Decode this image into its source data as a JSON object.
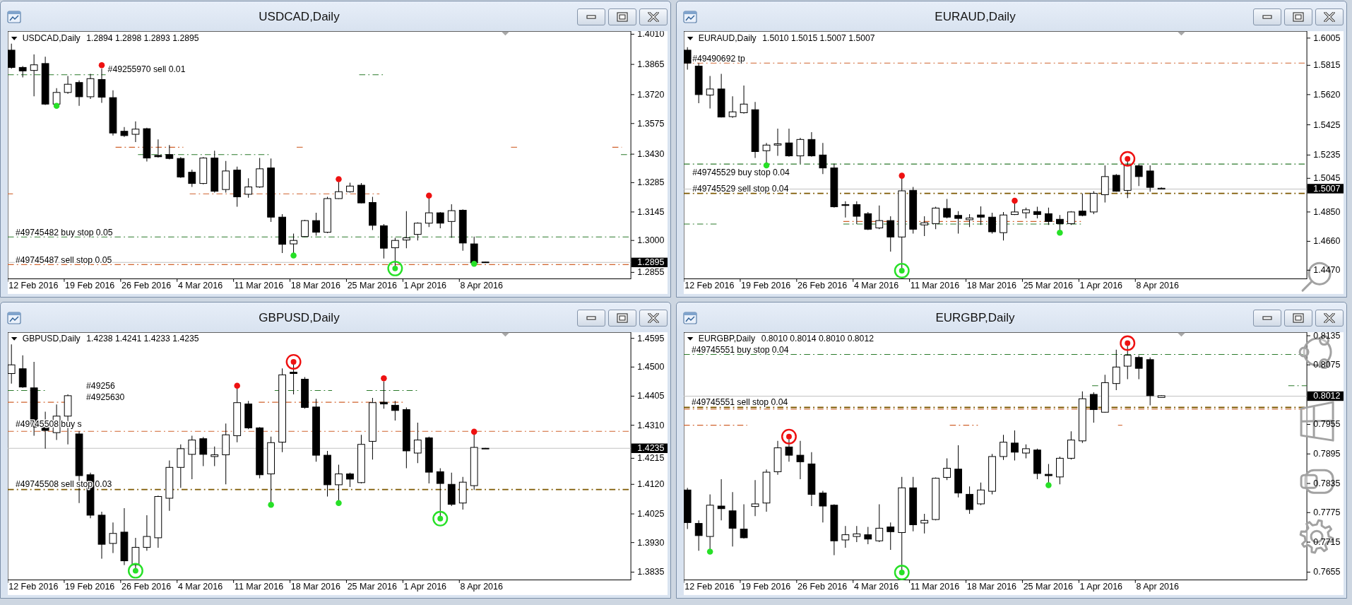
{
  "windows": [
    {
      "title": "USDCAD,Daily",
      "legend": {
        "symbol": "USDCAD,Daily",
        "ohlc": "1.2894 1.2898 1.2893 1.2895"
      },
      "order_labels": [
        "#49255970 sell 0.01",
        "#49745482 buy stop 0.05",
        "#49745487 sell stop 0.05"
      ],
      "price_scale": [
        "1.4010",
        "1.3865",
        "1.3720",
        "1.3575",
        "1.3430",
        "1.3285",
        "1.3145",
        "1.3000",
        "1.2855"
      ],
      "current_price": "1.2895",
      "dates": [
        "12 Feb 2016",
        "19 Feb 2016",
        "26 Feb 2016",
        "4 Mar 2016",
        "11 Mar 2016",
        "18 Mar 2016",
        "25 Mar 2016",
        "1 Apr 2016",
        "8 Apr 2016"
      ]
    },
    {
      "title": "EURAUD,Daily",
      "legend": {
        "symbol": "EURAUD,Daily",
        "ohlc": "1.5010 1.5015 1.5007 1.5007"
      },
      "order_labels": [
        "#49490692 tp",
        "#49745529 buy stop 0.04",
        "#49745529 sell stop 0.04"
      ],
      "price_scale": [
        "1.6005",
        "1.5815",
        "1.5620",
        "1.5425",
        "1.5235",
        "1.5045",
        "1.4850",
        "1.4660",
        "1.4470"
      ],
      "current_price": "1.5007",
      "dates": [
        "12 Feb 2016",
        "19 Feb 2016",
        "26 Feb 2016",
        "4 Mar 2016",
        "11 Mar 2016",
        "18 Mar 2016",
        "25 Mar 2016",
        "1 Apr 2016",
        "8 Apr 2016"
      ]
    },
    {
      "title": "GBPUSD,Daily",
      "legend": {
        "symbol": "GBPUSD,Daily",
        "ohlc": "1.4238 1.4241 1.4233 1.4235"
      },
      "order_labels": [
        "#49256",
        "#4925630",
        "#49745508 buy s",
        "#49745508 sell stop 0.03"
      ],
      "price_scale": [
        "1.4595",
        "1.4500",
        "1.4405",
        "1.4310",
        "1.4215",
        "1.4120",
        "1.4025",
        "1.3930",
        "1.3835"
      ],
      "current_price": "1.4235",
      "dates": [
        "12 Feb 2016",
        "19 Feb 2016",
        "26 Feb 2016",
        "4 Mar 2016",
        "11 Mar 2016",
        "18 Mar 2016",
        "25 Mar 2016",
        "1 Apr 2016",
        "8 Apr 2016"
      ]
    },
    {
      "title": "EURGBP,Daily",
      "legend": {
        "symbol": "EURGBP,Daily",
        "ohlc": "0.8010 0.8014 0.8010 0.8012"
      },
      "order_labels": [
        "#49745551 buy stop 0.04",
        "#49745551 sell stop 0.04"
      ],
      "price_scale": [
        "0.8135",
        "0.8075",
        "0.7955",
        "0.7895",
        "0.7835",
        "0.7775",
        "0.7715",
        "0.7655"
      ],
      "current_price": "0.8012",
      "dates": [
        "12 Feb 2016",
        "19 Feb 2016",
        "26 Feb 2016",
        "4 Mar 2016",
        "11 Mar 2016",
        "18 Mar 2016",
        "25 Mar 2016",
        "1 Apr 2016",
        "8 Apr 2016"
      ]
    }
  ]
}
